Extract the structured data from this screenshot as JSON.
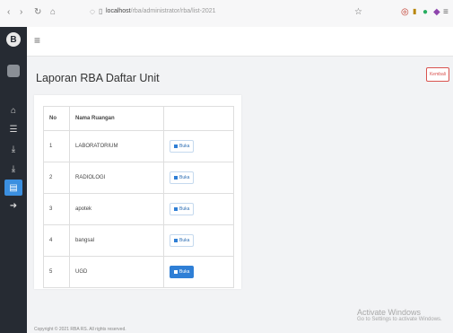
{
  "browser": {
    "back_icon": "back-arrow-icon",
    "url_host": "localhost",
    "url_path": "/rba/administrator/rba/list-2021"
  },
  "sidebar": {
    "logo_letter": "B",
    "items": [
      {
        "icon": "home-icon",
        "glyph": "⌂"
      },
      {
        "icon": "users-icon",
        "glyph": "☰"
      },
      {
        "icon": "download-icon",
        "glyph": "⤓"
      },
      {
        "icon": "download-icon",
        "glyph": "⤓"
      },
      {
        "icon": "chart-icon",
        "glyph": "▤"
      },
      {
        "icon": "logout-icon",
        "glyph": "➜"
      }
    ]
  },
  "header": {
    "menu_glyph": "≡"
  },
  "page": {
    "title": "Laporan RBA Daftar Unit",
    "back_label": "Kembali"
  },
  "table": {
    "headers": [
      "No",
      "Nama Ruangan",
      ""
    ],
    "rows": [
      {
        "no": "1",
        "name": "LABORATORIUM",
        "action": "Buka"
      },
      {
        "no": "2",
        "name": "RADIOLOGI",
        "action": "Buka"
      },
      {
        "no": "3",
        "name": "apotek",
        "action": "Buka"
      },
      {
        "no": "4",
        "name": "bangsal",
        "action": "Buka"
      },
      {
        "no": "5",
        "name": "UGD",
        "action": "Buka"
      }
    ]
  },
  "activate_windows": {
    "line1": "Activate Windows",
    "line2": "Go to Settings to activate Windows."
  },
  "footer": {
    "text": "Copyright © 2021 RBA RS. All rights reserved."
  }
}
